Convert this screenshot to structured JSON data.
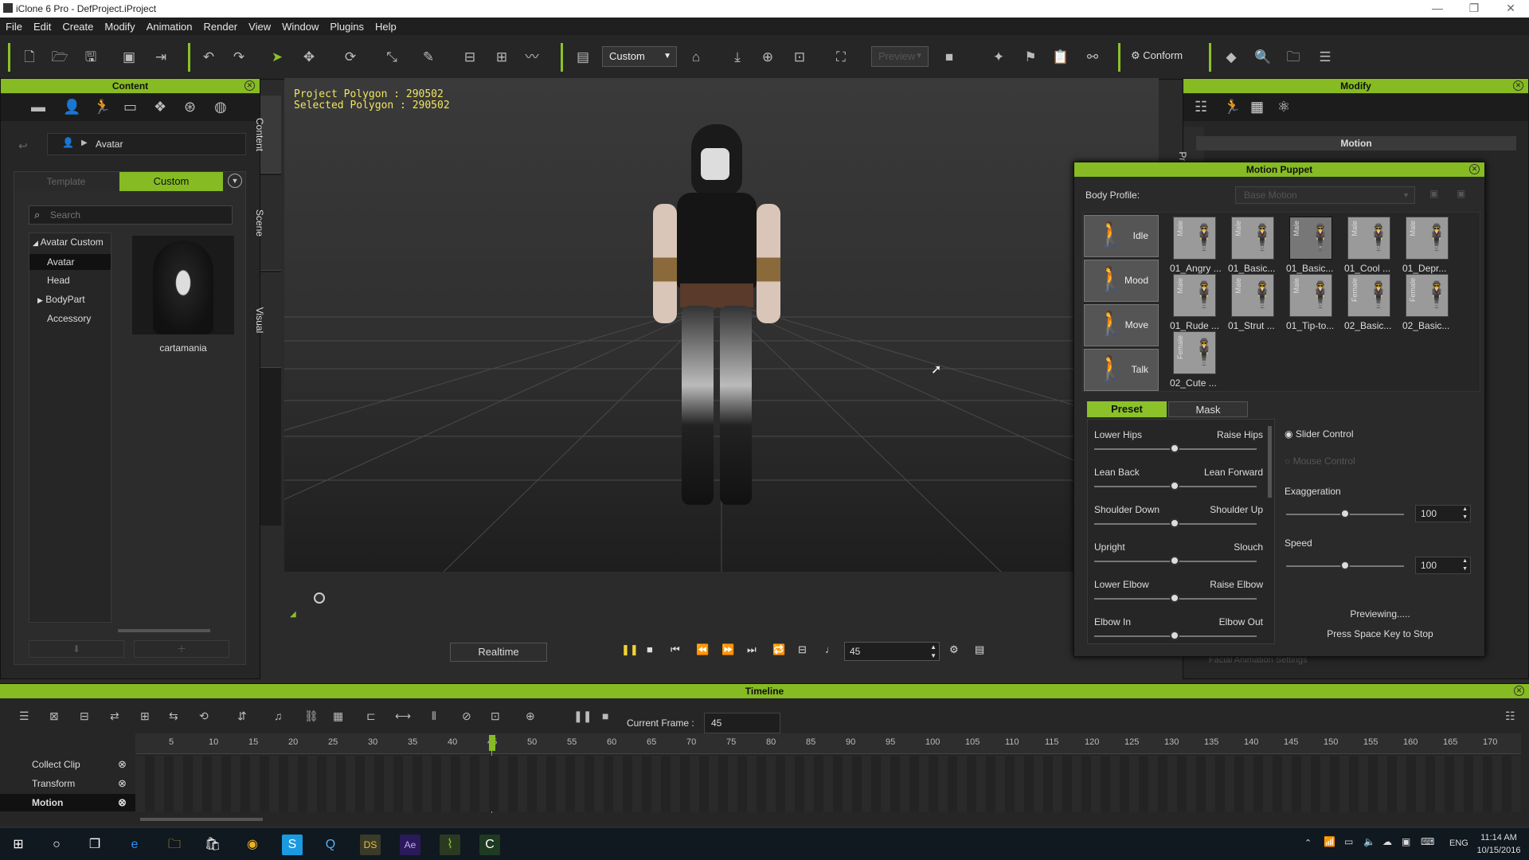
{
  "window": {
    "title": "iClone 6 Pro - DefProject.iProject"
  },
  "menu": [
    "File",
    "Edit",
    "Create",
    "Modify",
    "Animation",
    "Render",
    "View",
    "Window",
    "Plugins",
    "Help"
  ],
  "toolbar": {
    "view_mode": "Custom",
    "preview_label": "Preview",
    "conform_label": "Conform"
  },
  "content": {
    "header": "Content",
    "breadcrumb": "Avatar",
    "tab_template": "Template",
    "tab_custom": "Custom",
    "search_placeholder": "Search",
    "tree": [
      {
        "label": "Avatar Custom"
      },
      {
        "label": "Avatar"
      },
      {
        "label": "Head"
      },
      {
        "label": "BodyPart"
      },
      {
        "label": "Accessory"
      }
    ],
    "item_label": "cartamania"
  },
  "side_tabs": [
    "Content",
    "Scene",
    "Visual"
  ],
  "viewport": {
    "project_polygon": "Project Polygon : 290502",
    "selected_polygon": "Selected Polygon : 290502"
  },
  "playback": {
    "realtime_label": "Realtime",
    "frame_value": "45"
  },
  "modify": {
    "header": "Modify",
    "project_tab": "Project",
    "section": "Motion",
    "facial_settings": "Facial Animation Settings"
  },
  "puppet": {
    "title": "Motion Puppet",
    "body_profile_label": "Body Profile:",
    "body_profile_value": "Base Motion",
    "categories": [
      {
        "label": "Idle"
      },
      {
        "label": "Mood"
      },
      {
        "label": "Move"
      },
      {
        "label": "Talk"
      }
    ],
    "thumbnails": [
      {
        "label": "01_Angry ...",
        "gender": "Male"
      },
      {
        "label": "01_Basic...",
        "gender": "Male"
      },
      {
        "label": "01_Basic...",
        "gender": "Male"
      },
      {
        "label": "01_Cool ...",
        "gender": "Male"
      },
      {
        "label": "01_Depr...",
        "gender": "Male"
      },
      {
        "label": "01_Rude ...",
        "gender": "Male"
      },
      {
        "label": "01_Strut ...",
        "gender": "Male"
      },
      {
        "label": "01_Tip-to...",
        "gender": "Male"
      },
      {
        "label": "02_Basic...",
        "gender": "Female"
      },
      {
        "label": "02_Basic...",
        "gender": "Female"
      },
      {
        "label": "02_Cute ...",
        "gender": "Female"
      }
    ],
    "tab_preset": "Preset",
    "tab_mask": "Mask",
    "sliders": [
      {
        "left": "Lower Hips",
        "right": "Raise Hips",
        "value": 0.5
      },
      {
        "left": "Lean Back",
        "right": "Lean Forward",
        "value": 0.5
      },
      {
        "left": "Shoulder Down",
        "right": "Shoulder Up",
        "value": 0.5
      },
      {
        "left": "Upright",
        "right": "Slouch",
        "value": 0.5
      },
      {
        "left": "Lower Elbow",
        "right": "Raise Elbow",
        "value": 0.5
      },
      {
        "left": "Elbow In",
        "right": "Elbow Out",
        "value": 0.5
      }
    ],
    "slider_control": "Slider Control",
    "mouse_control": "Mouse Control",
    "exaggeration_label": "Exaggeration",
    "exaggeration_value": "100",
    "speed_label": "Speed",
    "speed_value": "100",
    "status_1": "Previewing.....",
    "status_2": "Press Space Key to Stop"
  },
  "timeline": {
    "header": "Timeline",
    "current_frame_label": "Current Frame :",
    "current_frame_value": "45",
    "ticks": [
      "5",
      "10",
      "15",
      "20",
      "25",
      "30",
      "35",
      "40",
      "45",
      "50",
      "55",
      "60",
      "65",
      "70",
      "75",
      "80",
      "85",
      "90",
      "95",
      "100",
      "105",
      "110",
      "115",
      "120",
      "125",
      "130",
      "135",
      "140",
      "145",
      "150",
      "155",
      "160",
      "165",
      "170"
    ],
    "tracks": [
      "Collect Clip",
      "Transform",
      "Motion"
    ]
  },
  "taskbar": {
    "time": "11:14 AM",
    "date": "10/15/2016",
    "lang": "ENG"
  },
  "colors": {
    "accent": "#86bb23",
    "stats_text": "#f2e560"
  }
}
